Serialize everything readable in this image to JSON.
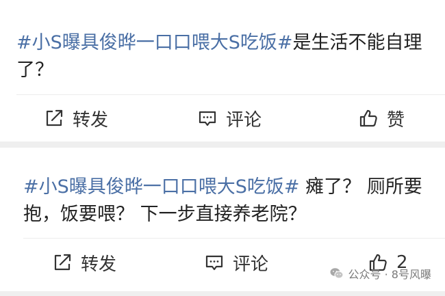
{
  "posts": [
    {
      "topic": "#小S曝具俊晔一口口喂大S吃饭#",
      "text": "是生活不能自理了？",
      "actions": {
        "repost": "转发",
        "comment": "评论",
        "like": "赞"
      }
    },
    {
      "topic": "#小S曝具俊晔一口口喂大S吃饭#",
      "text": " 瘫了？ 厕所要抱，饭要喂？ 下一步直接养老院？",
      "actions": {
        "repost": "转发",
        "comment": "评论",
        "like": "2"
      }
    }
  ],
  "watermark": {
    "text": "公众号 · 8号风曝",
    "icon": "wechat-icon"
  },
  "colors": {
    "topic": "#4a6fa5",
    "text": "#222222",
    "background": "#efefef",
    "card": "#ffffff"
  },
  "icons": {
    "repost": "repost-icon",
    "comment": "comment-icon",
    "like": "thumbs-up-icon"
  }
}
